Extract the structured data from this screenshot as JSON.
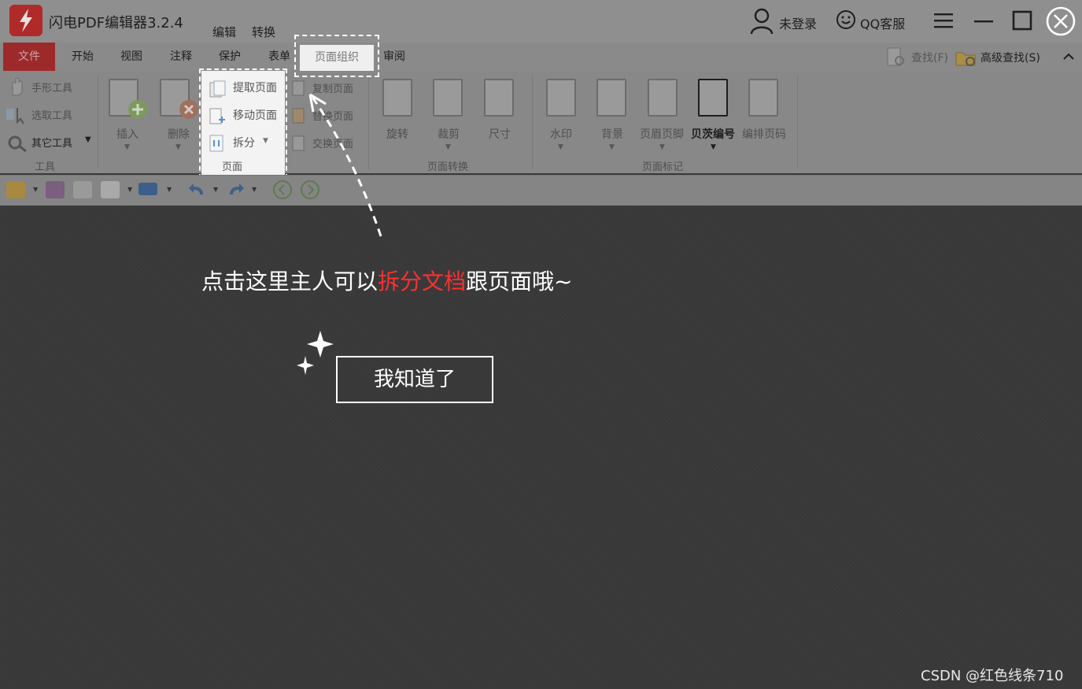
{
  "app": {
    "title": "闪电PDF编辑器3.2.4",
    "top_tabs": [
      "编辑",
      "转换"
    ],
    "login_text": "未登录",
    "support_text": "QQ客服"
  },
  "menu": {
    "file": "文件",
    "items": [
      "开始",
      "视图",
      "注释",
      "保护",
      "表单"
    ],
    "page_org": "页面组织",
    "review": "审阅",
    "search": "查找(F)",
    "advanced_search": "高级查找(S)"
  },
  "ribbon": {
    "tools": {
      "hand": "手形工具",
      "select": "选取工具",
      "other": "其它工具",
      "group": "工具"
    },
    "insert": "插入",
    "delete": "删除",
    "page_group": {
      "extract": "提取页面",
      "move": "移动页面",
      "split": "拆分",
      "label": "页面"
    },
    "copy": "复制页面",
    "replace": "替换页面",
    "swap": "交换页面",
    "convert": {
      "rotate": "旋转",
      "crop": "裁剪",
      "size": "尺寸",
      "label": "页面转换"
    },
    "mark": {
      "watermark": "水印",
      "background": "背景",
      "header_footer": "页眉页脚",
      "bates": "贝茨编号",
      "numbering": "编排页码",
      "label": "页面标记"
    }
  },
  "overlay": {
    "hint_before": "点击这里主人可以",
    "hint_highlight": "拆分文档",
    "hint_after": "跟页面哦~",
    "ok_button": "我知道了"
  },
  "watermark": "CSDN @红色线条710",
  "colors": {
    "accent_red": "#ff3030",
    "file_tab": "#9d2a2a"
  }
}
